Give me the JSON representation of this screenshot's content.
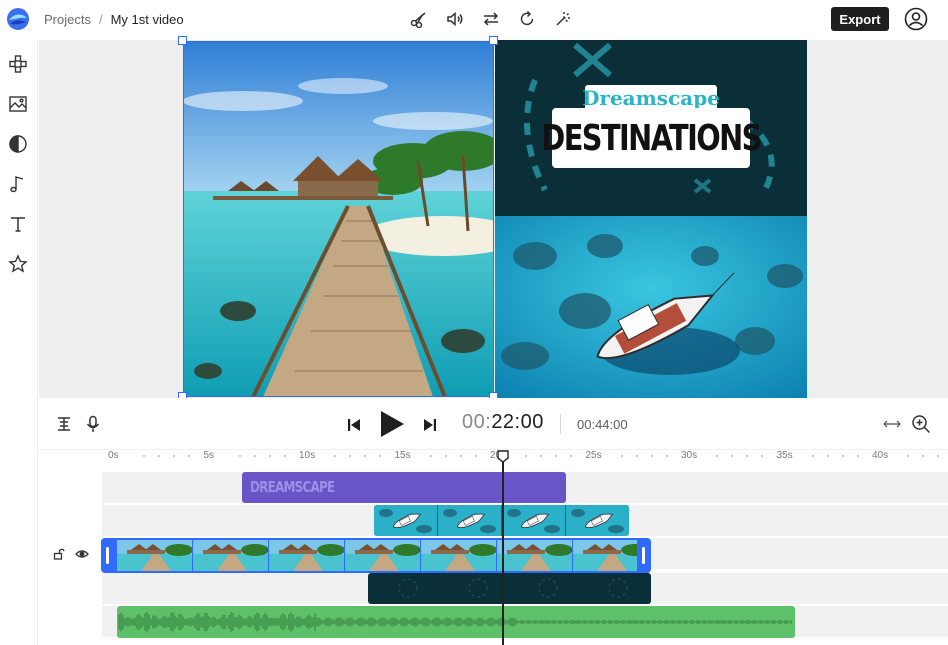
{
  "breadcrumb": {
    "parent": "Projects",
    "separator": "/",
    "current": "My 1st video"
  },
  "toolbar": {
    "export_label": "Export",
    "tools": [
      "scissors-icon",
      "volume-icon",
      "swap-icon",
      "rotate-icon",
      "magic-wand-icon"
    ]
  },
  "sidebar": {
    "items": [
      "elements-icon",
      "media-icon",
      "filters-icon",
      "audio-icon",
      "text-icon",
      "favorites-icon"
    ]
  },
  "canvas": {
    "title_script": "Dreamscape",
    "title_bold": "DESTINATIONS"
  },
  "player": {
    "current_dim": "00:",
    "current_main": "22:00",
    "total": "00:44:00"
  },
  "timeline": {
    "ruler_labels": [
      "0s",
      "5s",
      "10s",
      "15s",
      "20s",
      "25s",
      "30s",
      "35s",
      "40s"
    ],
    "text_clip_label": "DREAMSCAPE",
    "playhead_seconds": 20.4
  },
  "colors": {
    "selection": "#2f6bff",
    "text_clip": "#6a55c8",
    "audio_clip": "#5fc06a",
    "overlay_clip": "#0b2f38",
    "teal": "#2ab4c4"
  }
}
